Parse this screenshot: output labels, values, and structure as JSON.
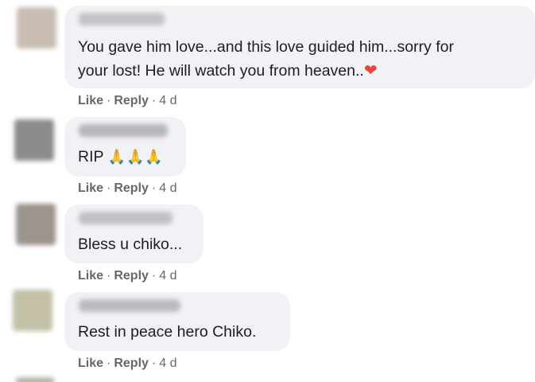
{
  "comments": [
    {
      "text": "You gave him love...and this love guided him...sorry for\nyour lost! He will watch you from heaven..",
      "emoji": "❤",
      "like": "Like",
      "reply": "Reply",
      "time": "4 d",
      "avatar_color": "#c9bdb2",
      "author_color": "#c2c4c8"
    },
    {
      "text": "RIP ",
      "emoji": "🙏🙏🙏",
      "like": "Like",
      "reply": "Reply",
      "time": "4 d",
      "avatar_color": "#8c8c8c",
      "author_color": "#b5b6ba"
    },
    {
      "text": "Bless u chiko...",
      "emoji": "",
      "like": "Like",
      "reply": "Reply",
      "time": "4 d",
      "avatar_color": "#9c948e",
      "author_color": "#bfc1c4"
    },
    {
      "text": "Rest in peace hero Chiko.",
      "emoji": "",
      "like": "Like",
      "reply": "Reply",
      "time": "4 d",
      "avatar_color": "#c3c0a6",
      "author_color": "#b9bbbf"
    }
  ],
  "separator": "·",
  "colors": {
    "bubble_bg": "#f0f2f5",
    "text": "#1c1e21",
    "meta": "#65676b",
    "heart": "#e8453c",
    "pray": "#f1b22c"
  }
}
